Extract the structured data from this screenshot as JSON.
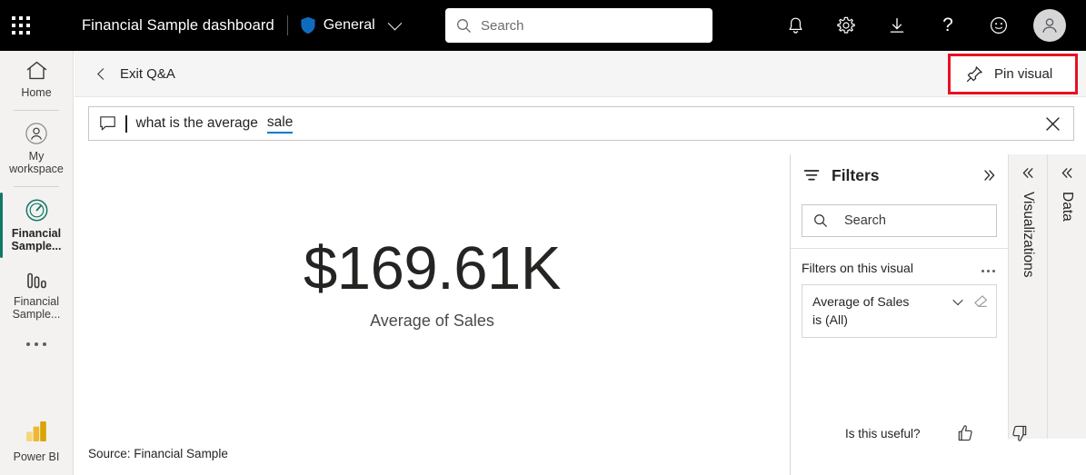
{
  "header": {
    "waffle_name": "waffle-menu",
    "app_title": "Financial Sample  dashboard",
    "workspace": "General",
    "search_placeholder": "Search",
    "search_value": "",
    "icons": [
      "notifications-icon",
      "settings-icon",
      "download-icon",
      "help-icon",
      "feedback-icon",
      "account-avatar"
    ]
  },
  "sidebar": {
    "items": [
      {
        "label": "Home",
        "icon": "home-icon",
        "selected": false
      },
      {
        "label": "My workspace",
        "icon": "person-circle-icon",
        "selected": false
      },
      {
        "label": "Financial Sample...",
        "icon": "dashboard-gauge-icon",
        "selected": true
      },
      {
        "label": "Financial Sample...",
        "icon": "report-bars-icon",
        "selected": false
      }
    ],
    "more_label": "more-options",
    "footer_label": "Power BI"
  },
  "qa_toolbar": {
    "exit_label": "Exit Q&A",
    "pin_label": "Pin visual",
    "highlight_color": "#e81123"
  },
  "question": {
    "text_plain": "what is the average ",
    "text_term": "sale",
    "full_text": "what is the average sale",
    "close_label": "close-qa"
  },
  "visual": {
    "value": "$169.61K",
    "label": "Average of Sales",
    "source": "Source: Financial Sample"
  },
  "filters": {
    "title": "Filters",
    "search_placeholder": "Search",
    "search_value": "",
    "section_label": "Filters on this visual",
    "cards": [
      {
        "title": "Average of Sales",
        "sub": "is (All)"
      }
    ]
  },
  "rails": [
    {
      "label": "Visualizations"
    },
    {
      "label": "Data"
    }
  ],
  "feedback": {
    "prompt": "Is this useful?",
    "up": "thumbs-up-icon",
    "down": "thumbs-down-icon"
  },
  "colors": {
    "header_bg": "#000000",
    "accent_selected": "#117865",
    "link_underline": "#0078d4",
    "annotation_red": "#e81123"
  }
}
